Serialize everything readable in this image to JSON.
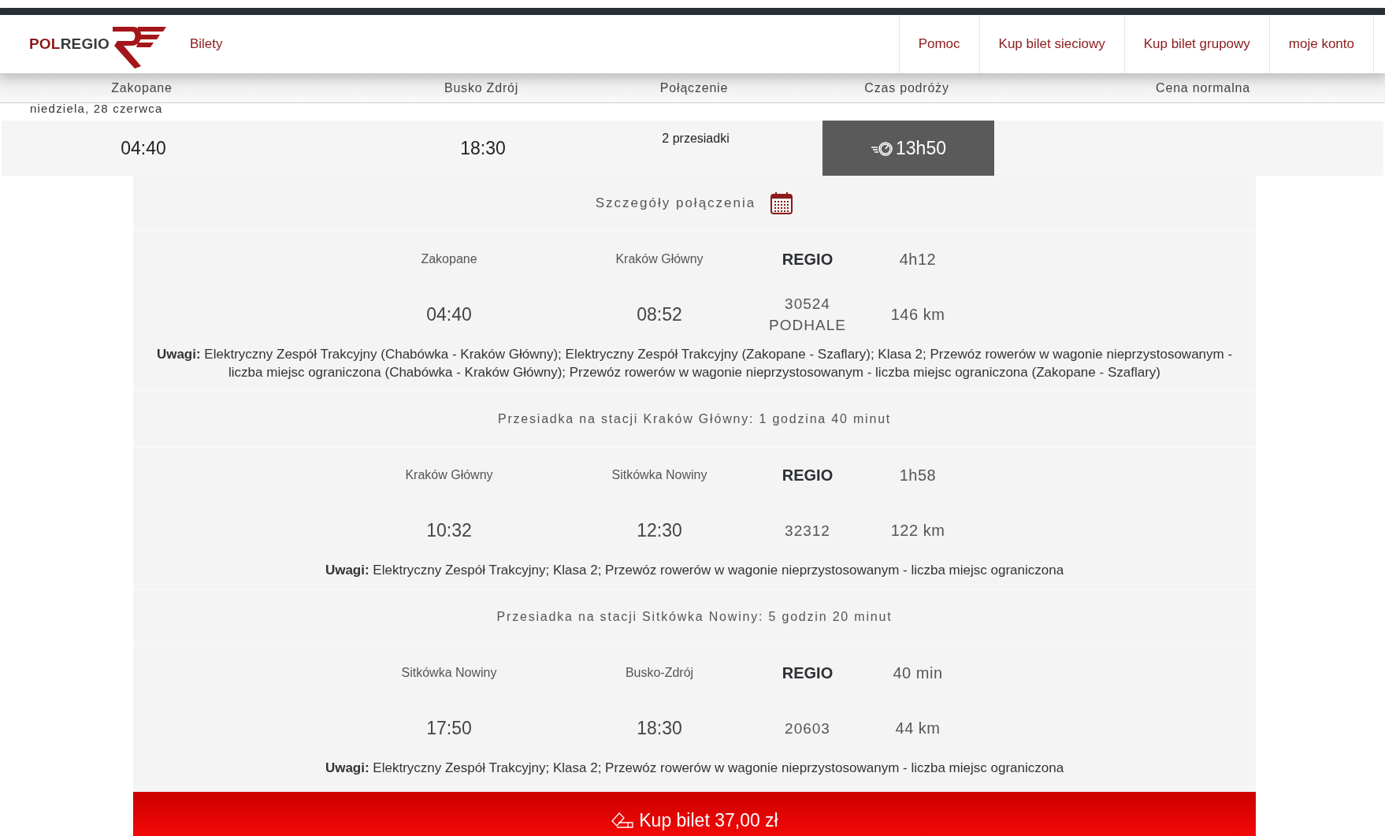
{
  "header": {
    "logo": {
      "part_1": "POL",
      "part_2": "REGIO"
    },
    "section_link": "Bilety",
    "nav": [
      "Pomoc",
      "Kup bilet sieciowy",
      "Kup bilet grupowy",
      "moje konto"
    ]
  },
  "columns": [
    "Zakopane",
    "Busko Zdrój",
    "Połączenie",
    "Czas podróży",
    "Cena normalna"
  ],
  "date": "niedziela, 28 czerwca",
  "summary": {
    "departure": "04:40",
    "arrival": "18:30",
    "connection": "2 przesiadki",
    "duration": "13h50"
  },
  "details": {
    "title": "Szczegóły połączenia",
    "sections": [
      {
        "kind": "leg",
        "from": "Zakopane",
        "to": "Kraków Główny",
        "carrier": "REGIO",
        "duration": "4h12",
        "departure": "04:40",
        "arrival": "08:52",
        "train": "30524",
        "train_name": "PODHALE",
        "distance": "146 km",
        "notes": "**Uwagi:** Elektryczny Zespół Trakcyjny (Chabówka - Kraków Główny); Elektryczny Zespół Trakcyjny (Zakopane - Szaflary); Klasa 2; Przewóz rowerów w wagonie nieprzystosowanym - liczba miejsc ograniczona (Chabówka - Kraków Główny); Przewóz rowerów w wagonie nieprzystosowanym - liczba miejsc ograniczona (Zakopane - Szaflary)"
      },
      {
        "kind": "transfer",
        "text": "Przesiadka na stacji Kraków Główny: 1 godzina 40 minut"
      },
      {
        "kind": "leg",
        "from": "Kraków Główny",
        "to": "Sitkówka Nowiny",
        "carrier": "REGIO",
        "duration": "1h58",
        "departure": "10:32",
        "arrival": "12:30",
        "train": "32312",
        "distance": "122 km",
        "notes": "**Uwagi:** Elektryczny Zespół Trakcyjny; Klasa 2; Przewóz rowerów w wagonie nieprzystosowanym - liczba miejsc ograniczona"
      },
      {
        "kind": "transfer",
        "text": "Przesiadka na stacji Sitkówka Nowiny: 5 godzin 20 minut"
      },
      {
        "kind": "leg",
        "from": "Sitkówka Nowiny",
        "to": "Busko-Zdrój",
        "carrier": "REGIO",
        "duration": "40 min",
        "departure": "17:50",
        "arrival": "18:30",
        "train": "20603",
        "distance": "44 km",
        "notes": "**Uwagi:** Elektryczny Zespół Trakcyjny; Klasa 2; Przewóz rowerów w wagonie nieprzystosowanym - liczba miejsc ograniczona"
      }
    ]
  },
  "buy_button": "Kup bilet 37,00 zł"
}
